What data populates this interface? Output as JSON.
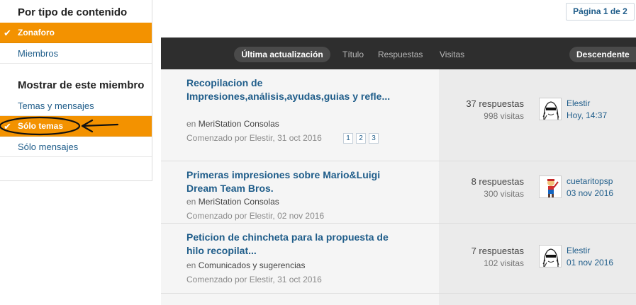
{
  "sidebar": {
    "content_heading": "Por tipo de contenido",
    "content_items": [
      {
        "label": "Zonaforo",
        "active": true
      },
      {
        "label": "Miembros",
        "active": false
      }
    ],
    "member_heading": "Mostrar de este miembro",
    "member_items": [
      {
        "label": "Temas y mensajes",
        "active": false
      },
      {
        "label": "Sólo temas",
        "active": true
      },
      {
        "label": "Sólo mensajes",
        "active": false
      }
    ]
  },
  "pager": {
    "label": "Página 1 de 2"
  },
  "sortbar": {
    "active": "Última actualización",
    "options": [
      "Título",
      "Respuestas",
      "Visitas"
    ],
    "direction": "Descendente"
  },
  "threads": [
    {
      "title": "Recopilacion de Impresiones,análisis,ayudas,guias y refle...",
      "forum_prefix": "en",
      "forum": "MeriStation Consolas",
      "started": "Comenzado por Elestir, 31 oct 2016",
      "pages": [
        "1",
        "2",
        "3"
      ],
      "replies": "37 respuestas",
      "views": "998 visitas",
      "last_user": "Elestir",
      "last_time": "Hoy, 14:37"
    },
    {
      "title": "Primeras impresiones sobre Mario&Luigi Dream Team Bros.",
      "forum_prefix": "en",
      "forum": "MeriStation Consolas",
      "started": "Comenzado por Elestir, 02 nov 2016",
      "pages": [],
      "replies": "8 respuestas",
      "views": "300 visitas",
      "last_user": "cuetaritopsp",
      "last_time": "03 nov 2016"
    },
    {
      "title": "Peticion de chincheta para la propuesta de hilo recopilat...",
      "forum_prefix": "en",
      "forum": "Comunicados y sugerencias",
      "started": "Comenzado por Elestir, 31 oct 2016",
      "pages": [],
      "replies": "7 respuestas",
      "views": "102 visitas",
      "last_user": "Elestir",
      "last_time": "01 nov 2016"
    }
  ],
  "colors": {
    "accent": "#f39200",
    "link": "#1f5d8a",
    "bar": "#2e2e2e"
  },
  "icons": {
    "active_marker": "check-icon"
  }
}
